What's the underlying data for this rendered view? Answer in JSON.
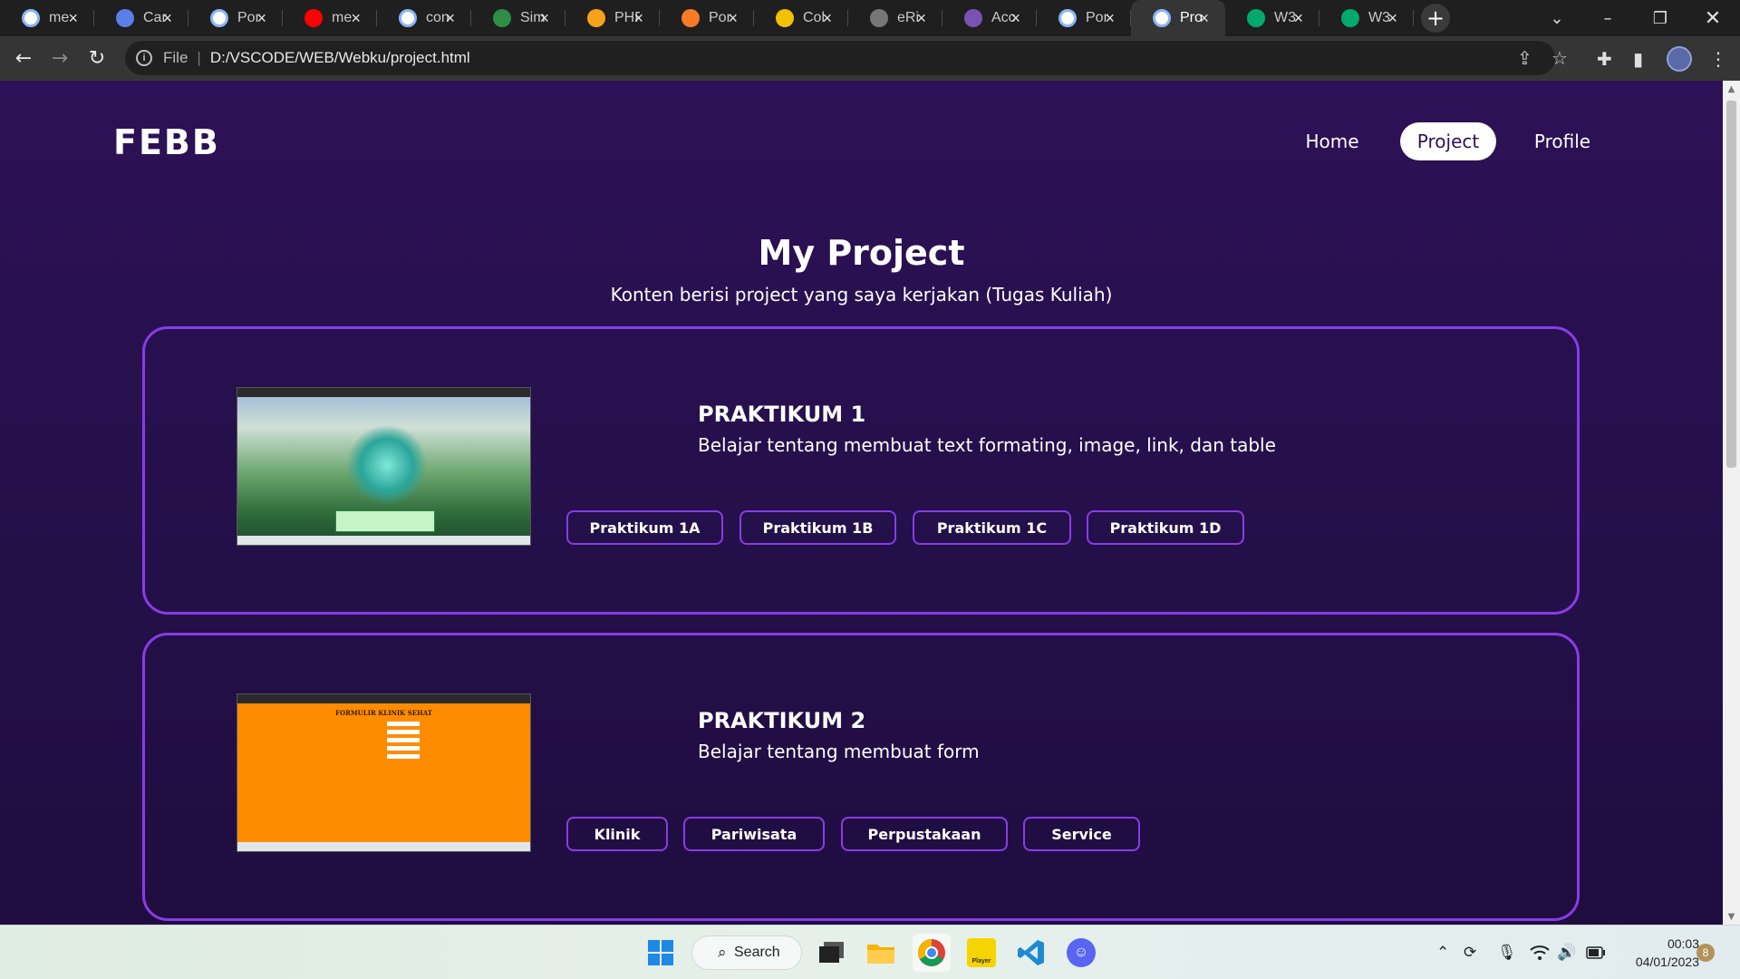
{
  "browser": {
    "tabs": [
      {
        "title": "me",
        "favicon": "google-icon",
        "color": "#ffffff"
      },
      {
        "title": "Car",
        "favicon": "canva-icon",
        "color": "#5a7fe8"
      },
      {
        "title": "Por",
        "favicon": "globe-icon",
        "color": "#ffffff"
      },
      {
        "title": "me",
        "favicon": "youtube-icon",
        "color": "#ff0000"
      },
      {
        "title": "con",
        "favicon": "google-icon",
        "color": "#ffffff"
      },
      {
        "title": "Sim",
        "favicon": "geeksforgeeks-icon",
        "color": "#2f8d46"
      },
      {
        "title": "PHF",
        "favicon": "php-icon",
        "color": "#f7a21b"
      },
      {
        "title": "Por",
        "favicon": "xampp-icon",
        "color": "#fb7a24"
      },
      {
        "title": "Col",
        "favicon": "shield-icon",
        "color": "#f2c200"
      },
      {
        "title": "eRi",
        "favicon": "loading-icon",
        "color": "#777777"
      },
      {
        "title": "Acc",
        "favicon": "bootstrap-icon",
        "color": "#7952b3"
      },
      {
        "title": "Por",
        "favicon": "globe-icon",
        "color": "#ffffff"
      },
      {
        "title": "Pro",
        "favicon": "globe-icon",
        "color": "#ffffff",
        "active": true
      },
      {
        "title": "W3",
        "favicon": "w3schools-icon",
        "color": "#04aa6d"
      },
      {
        "title": "W3",
        "favicon": "w3schools-icon",
        "color": "#04aa6d"
      }
    ],
    "address": {
      "scheme": "File",
      "url": "D:/VSCODE/WEB/Webku/project.html"
    }
  },
  "site": {
    "logo": "FEBB",
    "nav": [
      {
        "label": "Home",
        "active": false
      },
      {
        "label": "Project",
        "active": true
      },
      {
        "label": "Profile",
        "active": false
      }
    ],
    "heading": "My Project",
    "subheading": "Konten berisi project yang saya kerjakan (Tugas Kuliah)",
    "projects": [
      {
        "title": "PRAKTIKUM 1",
        "description": "Belajar tentang membuat text formating, image, link, dan table",
        "thumbnail": "anime-landscape-screenshot",
        "buttons": [
          "Praktikum 1A",
          "Praktikum 1B",
          "Praktikum 1C",
          "Praktikum 1D"
        ]
      },
      {
        "title": "PRAKTIKUM 2",
        "description": "Belajar tentang membuat form",
        "thumbnail": "orange-form-screenshot",
        "thumbnail_text": "FORMULIR KLINIK SEHAT",
        "buttons": [
          "Klinik",
          "Pariwisata",
          "Perpustakaan",
          "Service"
        ]
      }
    ],
    "colors": {
      "background": "#2a1150",
      "accent": "#8a3be6",
      "text": "#ffffff"
    }
  },
  "taskbar": {
    "search_label": "Search",
    "apps": [
      "windows-start-icon",
      "task-view-icon",
      "file-explorer-icon",
      "chrome-icon",
      "player-icon",
      "vscode-icon",
      "discord-icon"
    ],
    "player_label": "Player",
    "time": "00:03",
    "date": "04/01/2023",
    "notification_count": "8"
  }
}
